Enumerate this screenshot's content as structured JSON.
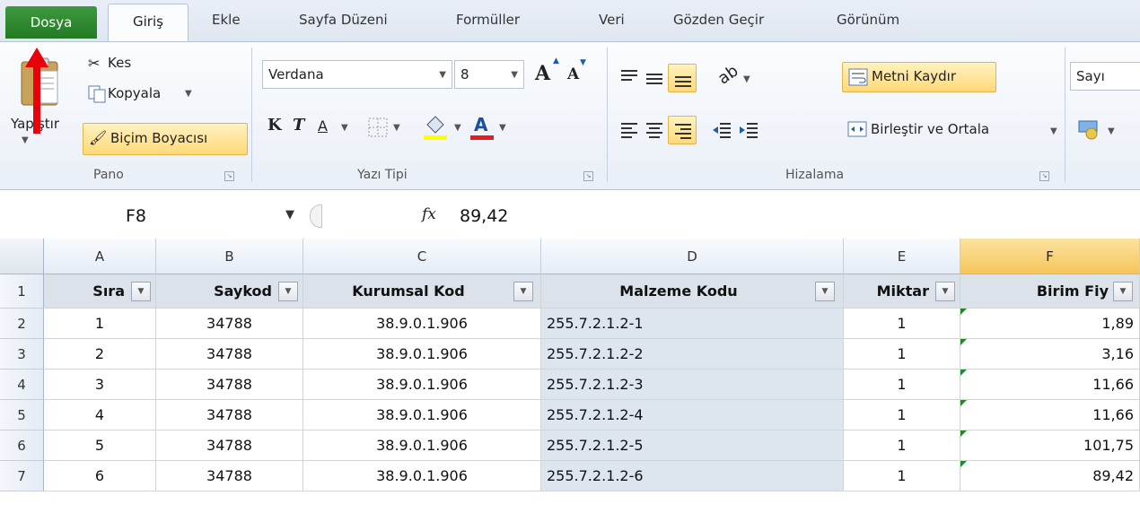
{
  "tabs": {
    "file": "Dosya",
    "home": "Giriş",
    "insert": "Ekle",
    "page_layout": "Sayfa Düzeni",
    "formulas": "Formüller",
    "data": "Veri",
    "review": "Gözden Geçir",
    "view": "Görünüm"
  },
  "clipboard": {
    "paste": "Yapıştır",
    "cut": "Kes",
    "copy": "Kopyala",
    "format_painter": "Biçim Boyacısı",
    "group_label": "Pano"
  },
  "font": {
    "name": "Verdana",
    "size": "8",
    "group_label": "Yazı Tipi",
    "bold": "K",
    "italic": "T",
    "underline": "A",
    "font_color_letter": "A",
    "grow": "A",
    "shrink": "A"
  },
  "alignment": {
    "wrap_text": "Metni Kaydır",
    "merge_center": "Birleştir ve Ortala",
    "group_label": "Hizalama"
  },
  "number": {
    "format": "Sayı"
  },
  "formula_bar": {
    "name_box": "F8",
    "fx": "fx",
    "value": "89,42"
  },
  "columns": [
    "A",
    "B",
    "C",
    "D",
    "E",
    "F"
  ],
  "headers": [
    "Sıra",
    "Saykod",
    "Kurumsal Kod",
    "Malzeme Kodu",
    "Miktar",
    "Birim Fiy"
  ],
  "rows": [
    {
      "num": "1",
      "cells": [
        "Sıra",
        "Saykod",
        "Kurumsal Kod",
        "Malzeme Kodu",
        "Miktar",
        "Birim Fiy"
      ]
    },
    {
      "num": "2",
      "cells": [
        "1",
        "34788",
        "38.9.0.1.906",
        "255.7.2.1.2-1",
        "1",
        "1,89"
      ]
    },
    {
      "num": "3",
      "cells": [
        "2",
        "34788",
        "38.9.0.1.906",
        "255.7.2.1.2-2",
        "1",
        "3,16"
      ]
    },
    {
      "num": "4",
      "cells": [
        "3",
        "34788",
        "38.9.0.1.906",
        "255.7.2.1.2-3",
        "1",
        "11,66"
      ]
    },
    {
      "num": "5",
      "cells": [
        "4",
        "34788",
        "38.9.0.1.906",
        "255.7.2.1.2-4",
        "1",
        "11,66"
      ]
    },
    {
      "num": "6",
      "cells": [
        "5",
        "34788",
        "38.9.0.1.906",
        "255.7.2.1.2-5",
        "1",
        "101,75"
      ]
    },
    {
      "num": "7",
      "cells": [
        "6",
        "34788",
        "38.9.0.1.906",
        "255.7.2.1.2-6",
        "1",
        "89,42"
      ]
    }
  ],
  "colors": {
    "file_tab": "#2a842a",
    "selected_col_header": "#f6c55a",
    "highlight_button": "#ffd978",
    "annotation_arrow": "#e8000b"
  },
  "icons": {
    "annotation_arrow": "red-arrow-icon"
  }
}
